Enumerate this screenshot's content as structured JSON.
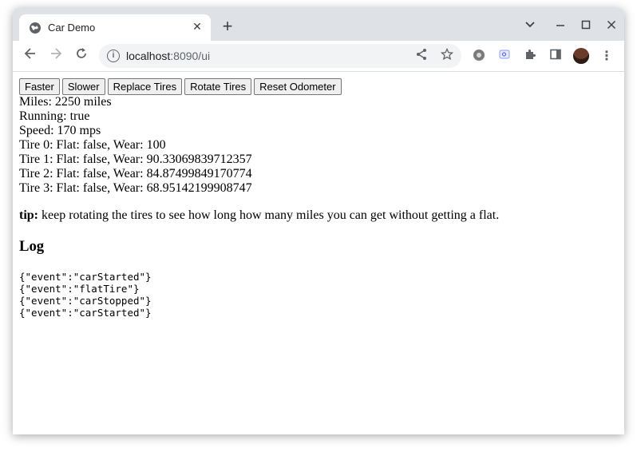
{
  "browser": {
    "tab_title": "Car Demo",
    "url_host": "localhost",
    "url_rest": ":8090/ui"
  },
  "page": {
    "buttons": [
      "Faster",
      "Slower",
      "Replace Tires",
      "Rotate Tires",
      "Reset Odometer"
    ],
    "status": {
      "miles": "Miles: 2250 miles",
      "running": "Running: true",
      "speed": "Speed: 170 mps",
      "tires": [
        "Tire 0: Flat: false, Wear: 100",
        "Tire 1: Flat: false, Wear: 90.33069839712357",
        "Tire 2: Flat: false, Wear: 84.87499849170774",
        "Tire 3: Flat: false, Wear: 68.95142199908747"
      ]
    },
    "tip_label": "tip:",
    "tip_text": " keep rotating the tires to see how long how many miles you can get without getting a flat.",
    "log_heading": "Log",
    "log_entries": [
      "{\"event\":\"carStarted\"}",
      "{\"event\":\"flatTire\"}",
      "{\"event\":\"carStopped\"}",
      "{\"event\":\"carStarted\"}"
    ]
  },
  "icons": {
    "tab_favicon": "globe-icon",
    "close": "close-icon",
    "new_tab": "plus-icon",
    "back": "back-arrow-icon",
    "forward": "forward-arrow-icon",
    "reload": "reload-icon",
    "info": "info-icon",
    "share": "share-icon",
    "bookmark": "star-icon",
    "extensions": "puzzle-icon",
    "side_panel": "side-panel-icon",
    "menu": "kebab-menu-icon"
  }
}
